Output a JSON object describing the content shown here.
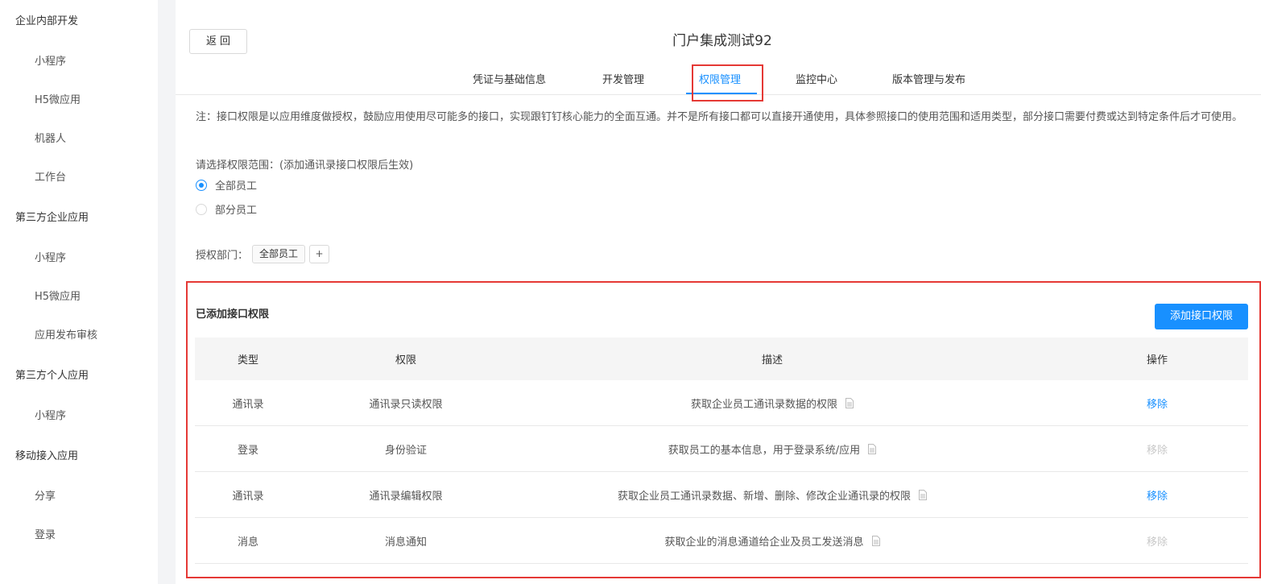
{
  "sidebar": {
    "groups": [
      {
        "label": "企业内部开发",
        "items": [
          "小程序",
          "H5微应用",
          "机器人",
          "工作台"
        ]
      },
      {
        "label": "第三方企业应用",
        "items": [
          "小程序",
          "H5微应用",
          "应用发布审核"
        ]
      },
      {
        "label": "第三方个人应用",
        "items": [
          "小程序"
        ]
      },
      {
        "label": "移动接入应用",
        "items": [
          "分享",
          "登录"
        ]
      }
    ]
  },
  "header": {
    "back_label": "返回",
    "title": "门户集成测试92"
  },
  "tabs": [
    {
      "label": "凭证与基础信息"
    },
    {
      "label": "开发管理"
    },
    {
      "label": "权限管理"
    },
    {
      "label": "监控中心"
    },
    {
      "label": "版本管理与发布"
    }
  ],
  "active_tab": "权限管理",
  "note": "注：接口权限是以应用维度做授权，鼓励应用使用尽可能多的接口，实现跟钉钉核心能力的全面互通。并不是所有接口都可以直接开通使用，具体参照接口的使用范围和适用类型，部分接口需要付费或达到特定条件后才可使用。",
  "scope": {
    "label": "请选择权限范围：(添加通讯录接口权限后生效)",
    "options": [
      "全部员工",
      "部分员工"
    ],
    "selected": "全部员工"
  },
  "dept": {
    "label": "授权部门：",
    "tag": "全部员工",
    "add": "+"
  },
  "permissions": {
    "title": "已添加接口权限",
    "add_button": "添加接口权限",
    "columns": [
      "类型",
      "权限",
      "描述",
      "操作"
    ],
    "rows": [
      {
        "type": "通讯录",
        "perm": "通讯录只读权限",
        "desc": "获取企业员工通讯录数据的权限",
        "op": "移除",
        "enabled": true
      },
      {
        "type": "登录",
        "perm": "身份验证",
        "desc": "获取员工的基本信息，用于登录系统/应用",
        "op": "移除",
        "enabled": false
      },
      {
        "type": "通讯录",
        "perm": "通讯录编辑权限",
        "desc": "获取企业员工通讯录数据、新增、删除、修改企业通讯录的权限",
        "op": "移除",
        "enabled": true
      },
      {
        "type": "消息",
        "perm": "消息通知",
        "desc": "获取企业的消息通道给企业及员工发送消息",
        "op": "移除",
        "enabled": false
      }
    ]
  },
  "colors": {
    "accent": "#1890ff",
    "highlight_box": "#e53935",
    "disabled": "#c8c8c8"
  }
}
